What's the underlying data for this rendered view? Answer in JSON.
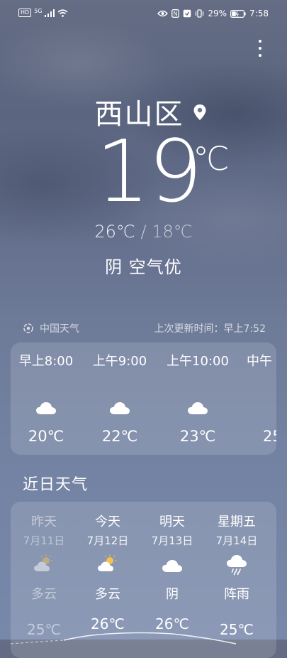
{
  "status_bar": {
    "left_label": "HD",
    "network_label": "5G",
    "battery_percent": "29%",
    "time": "7:58"
  },
  "location": {
    "city": "西山区"
  },
  "current": {
    "temperature": "19",
    "unit": "℃",
    "high": "26℃",
    "separator": "/",
    "low": "18℃",
    "condition": "阴 空气优"
  },
  "provider": {
    "name": "中国天气",
    "updated": "上次更新时间：早上7:52"
  },
  "hourly": [
    {
      "time": "早上8:00",
      "temp": "20℃",
      "icon": "cloud-icon"
    },
    {
      "time": "上午9:00",
      "temp": "22℃",
      "icon": "cloud-icon"
    },
    {
      "time": "上午10:00",
      "temp": "23℃",
      "icon": "cloud-icon"
    },
    {
      "time": "中午",
      "temp": "25",
      "icon": "cloud-icon"
    }
  ],
  "daily_title": "近日天气",
  "daily": [
    {
      "day": "昨天",
      "date": "7月11日",
      "condition": "多云",
      "high": "25℃",
      "icon": "partly-cloudy-icon",
      "past": true
    },
    {
      "day": "今天",
      "date": "7月12日",
      "condition": "多云",
      "high": "26℃",
      "icon": "partly-cloudy-icon",
      "past": false
    },
    {
      "day": "明天",
      "date": "7月13日",
      "condition": "阴",
      "high": "26℃",
      "icon": "cloud-icon",
      "past": false
    },
    {
      "day": "星期五",
      "date": "7月14日",
      "condition": "阵雨",
      "high": "25℃",
      "icon": "rain-cloud-icon",
      "past": false
    }
  ],
  "colors": {
    "sky_top": "#646d84",
    "sky_bottom": "#7888aa",
    "sun": "#f5c24a",
    "card": "rgba(255,255,255,0.14)"
  }
}
